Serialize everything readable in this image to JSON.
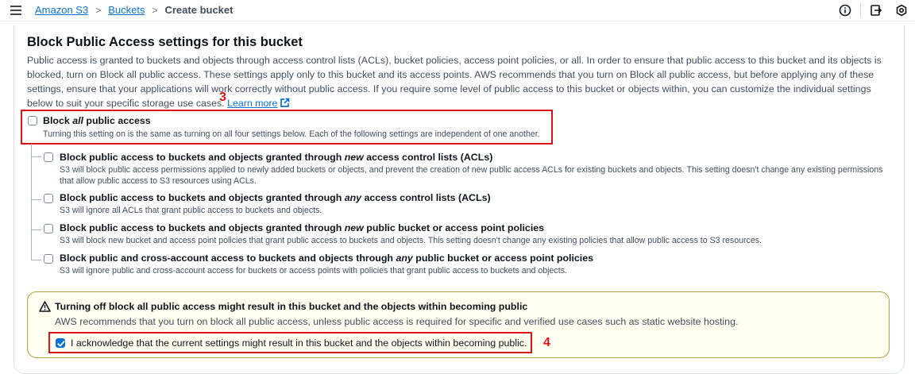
{
  "breadcrumb": {
    "items": [
      "Amazon S3",
      "Buckets"
    ],
    "separator": ">",
    "current": "Create bucket"
  },
  "top_icons": [
    "info-icon",
    "export-icon",
    "settings-icon"
  ],
  "panel": {
    "title": "Block Public Access settings for this bucket",
    "description": "Public access is granted to buckets and objects through access control lists (ACLs), bucket policies, access point policies, or all. In order to ensure that public access to this bucket and its objects is blocked, turn on Block all public access. These settings apply only to this bucket and its access points. AWS recommends that you turn on Block all public access, but before applying any of these settings, ensure that your applications will work correctly without public access. If you require some level of public access to this bucket or objects within, you can customize the individual settings below to suit your specific storage use cases.",
    "learn_more": "Learn more"
  },
  "annotations": {
    "three": "3",
    "four": "4"
  },
  "block_all": {
    "label_pre": "Block ",
    "label_em": "all",
    "label_post": " public access",
    "description": "Turning this setting on is the same as turning on all four settings below. Each of the following settings are independent of one another.",
    "checked": false
  },
  "options": [
    {
      "title_pre": "Block public access to buckets and objects granted through ",
      "title_em": "new",
      "title_post": " access control lists (ACLs)",
      "description": "S3 will block public access permissions applied to newly added buckets or objects, and prevent the creation of new public access ACLs for existing buckets and objects. This setting doesn't change any existing permissions that allow public access to S3 resources using ACLs.",
      "checked": false
    },
    {
      "title_pre": "Block public access to buckets and objects granted through ",
      "title_em": "any",
      "title_post": " access control lists (ACLs)",
      "description": "S3 will ignore all ACLs that grant public access to buckets and objects.",
      "checked": false
    },
    {
      "title_pre": "Block public access to buckets and objects granted through ",
      "title_em": "new",
      "title_post": " public bucket or access point policies",
      "description": "S3 will block new bucket and access point policies that grant public access to buckets and objects. This setting doesn't change any existing policies that allow public access to S3 resources.",
      "checked": false
    },
    {
      "title_pre": "Block public and cross-account access to buckets and objects through ",
      "title_em": "any",
      "title_post": " public bucket or access point policies",
      "description": "S3 will ignore public and cross-account access for buckets or access points with policies that grant public access to buckets and objects.",
      "checked": false
    }
  ],
  "warning": {
    "title": "Turning off block all public access might result in this bucket and the objects within becoming public",
    "body": "AWS recommends that you turn on block all public access, unless public access is required for specific and verified use cases such as static website hosting.",
    "acknowledge_label": "I acknowledge that the current settings might result in this bucket and the objects within becoming public.",
    "acknowledge_checked": true
  },
  "colors": {
    "link": "#0972d3",
    "highlight": "#d91515",
    "warning_bg": "#fffef0",
    "warning_border": "#b0a047",
    "checkbox_checked": "#0972d3"
  }
}
